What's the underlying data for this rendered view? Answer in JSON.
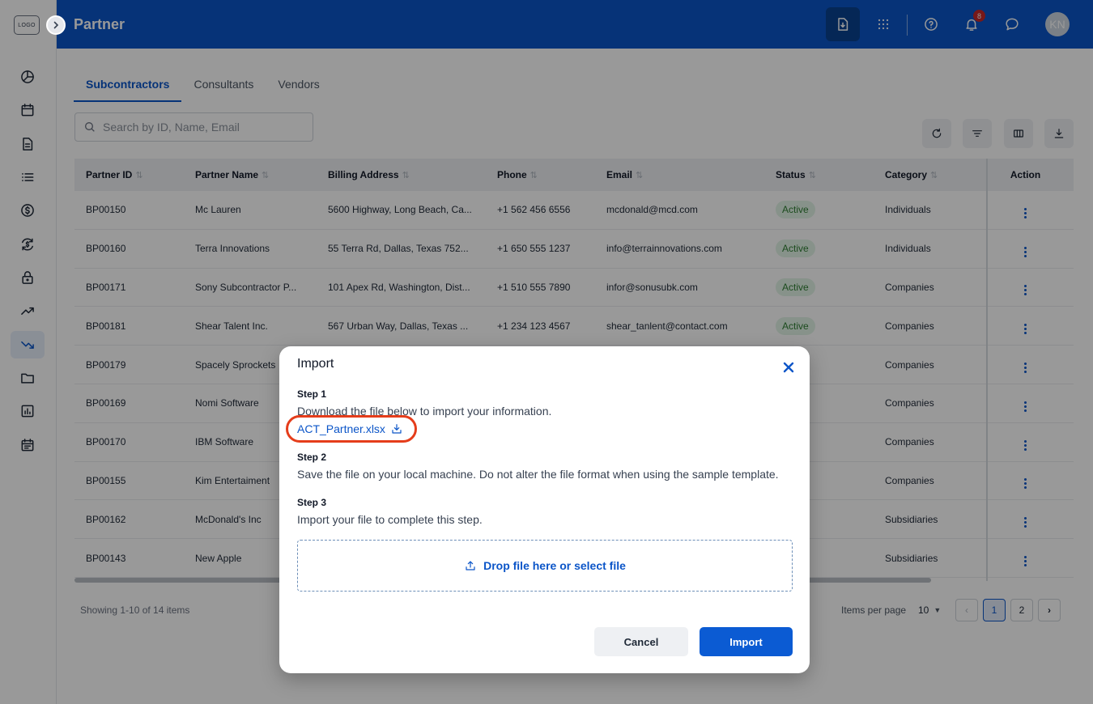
{
  "logo": "LOGO",
  "header": {
    "title": "Partner",
    "notifications_count": "8",
    "avatar_initials": "KN"
  },
  "sidebar": {
    "items": [
      {
        "icon": "dashboard-icon"
      },
      {
        "icon": "calendar-icon"
      },
      {
        "icon": "document-icon"
      },
      {
        "icon": "list-icon"
      },
      {
        "icon": "dollar-icon"
      },
      {
        "icon": "currency-exchange-icon"
      },
      {
        "icon": "lock-icon"
      },
      {
        "icon": "trending-up-icon"
      },
      {
        "icon": "trending-down-icon",
        "active": true
      },
      {
        "icon": "folder-icon"
      },
      {
        "icon": "report-icon"
      },
      {
        "icon": "schedule-icon"
      }
    ]
  },
  "tabs": [
    "Subcontractors",
    "Consultants",
    "Vendors"
  ],
  "search": {
    "placeholder": "Search by ID, Name, Email"
  },
  "table": {
    "headers": [
      "Partner ID",
      "Partner Name",
      "Billing Address",
      "Phone",
      "Email",
      "Status",
      "Category",
      "Action"
    ],
    "rows": [
      {
        "id": "BP00150",
        "name": "Mc Lauren",
        "address": "5600 Highway, Long Beach, Ca...",
        "phone": "+1 562 456 6556",
        "email": "mcdonald@mcd.com",
        "status": "Active",
        "category": "Individuals"
      },
      {
        "id": "BP00160",
        "name": "Terra Innovations",
        "address": "55 Terra Rd, Dallas, Texas 752...",
        "phone": "+1 650 555 1237",
        "email": "info@terrainnovations.com",
        "status": "Active",
        "category": "Individuals"
      },
      {
        "id": "BP00171",
        "name": "Sony Subcontractor P...",
        "address": "101 Apex Rd, Washington, Dist...",
        "phone": "+1 510 555 7890",
        "email": "infor@sonusubk.com",
        "status": "Active",
        "category": "Companies"
      },
      {
        "id": "BP00181",
        "name": "Shear Talent Inc.",
        "address": "567 Urban Way, Dallas, Texas ...",
        "phone": "+1 234 123 4567",
        "email": "shear_tanlent@contact.com",
        "status": "Active",
        "category": "Companies"
      },
      {
        "id": "BP00179",
        "name": "Spacely Sprockets",
        "address": "",
        "phone": "",
        "email": "",
        "status": "",
        "category": "Companies"
      },
      {
        "id": "BP00169",
        "name": "Nomi Software",
        "address": "",
        "phone": "",
        "email": "",
        "status": "",
        "category": "Companies"
      },
      {
        "id": "BP00170",
        "name": "IBM Software",
        "address": "",
        "phone": "",
        "email": "",
        "status": "",
        "category": "Companies"
      },
      {
        "id": "BP00155",
        "name": "Kim Entertaiment",
        "address": "",
        "phone": "",
        "email": "",
        "status": "",
        "category": "Companies"
      },
      {
        "id": "BP00162",
        "name": "McDonald's Inc",
        "address": "",
        "phone": "",
        "email": "",
        "status": "",
        "category": "Subsidiaries"
      },
      {
        "id": "BP00143",
        "name": "New Apple",
        "address": "",
        "phone": "",
        "email": "",
        "status": "",
        "category": "Subsidiaries"
      }
    ]
  },
  "footer": {
    "showing": "Showing 1-10 of 14 items",
    "items_per_page_label": "Items per page",
    "items_per_page_value": "10",
    "pages": [
      "1",
      "2"
    ],
    "current_page": "1"
  },
  "modal": {
    "title": "Import",
    "step1_title": "Step 1",
    "step1_text": "Download the file below to import your information.",
    "file_name": "ACT_Partner.xlsx",
    "step2_title": "Step 2",
    "step2_text": "Save the file on your local machine. Do not alter the file format when using the sample template.",
    "step3_title": "Step 3",
    "step3_text": "Import your file to complete this step.",
    "dropzone_text": "Drop file here or select file",
    "cancel_label": "Cancel",
    "import_label": "Import"
  },
  "colors": {
    "header": "#0a55c9",
    "accent": "#0b55c8",
    "status_active_bg": "#e2f4e6",
    "status_active_text": "#2e7d32",
    "highlight": "#e53d1b"
  }
}
